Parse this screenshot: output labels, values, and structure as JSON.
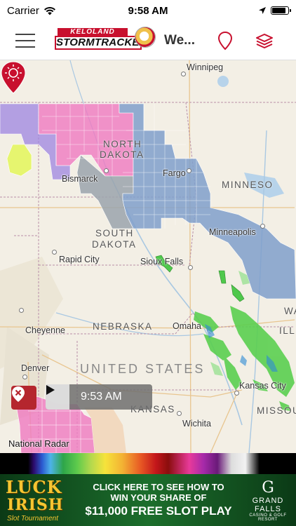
{
  "status": {
    "carrier": "Carrier",
    "time": "9:58 AM"
  },
  "nav": {
    "title": "We...",
    "logo_top": "KELOLAND",
    "logo_bottom": "STORMTRACKER"
  },
  "map": {
    "cities": {
      "winnipeg": "Winnipeg",
      "bismarck": "Bismarck",
      "fargo": "Fargo",
      "minneapolis": "Minneapolis",
      "rapid_city": "Rapid City",
      "sioux_falls": "Sioux Falls",
      "cheyenne": "Cheyenne",
      "omaha": "Omaha",
      "denver": "Denver",
      "kansas_city": "Kansas City",
      "wichita": "Wichita"
    },
    "states": {
      "north": "NORTH",
      "dakota_nd": "DAKOTA",
      "minnesota": "MINNESO",
      "south": "SOUTH",
      "dakota_sd": "DAKOTA",
      "nebraska": "NEBRASKA",
      "iowa": "WA",
      "kansas": "KANSAS",
      "missouri": "MISSOU",
      "illinois": "ILLI"
    },
    "country": "UNITED STATES",
    "player_time": "9:53 AM",
    "caption": "National Radar"
  },
  "ad": {
    "luck": "LUCK",
    "irish": "IRISH",
    "tourney": "Slot Tournament",
    "line1": "CLICK HERE TO SEE HOW TO",
    "line2": "WIN YOUR SHARE OF",
    "line3": "$11,000 FREE SLOT PLAY",
    "brand1": "GRAND",
    "brand2": "FALLS",
    "brand3": "CASINO & GOLF RESORT"
  },
  "colors": {
    "accent": "#c8102e",
    "warning_pink": "#ef79c0",
    "warning_purple": "#9d84e0",
    "warning_blue": "#7f9fcb",
    "warning_gray": "#9aa3ad",
    "warning_yellow": "#e4f562"
  }
}
